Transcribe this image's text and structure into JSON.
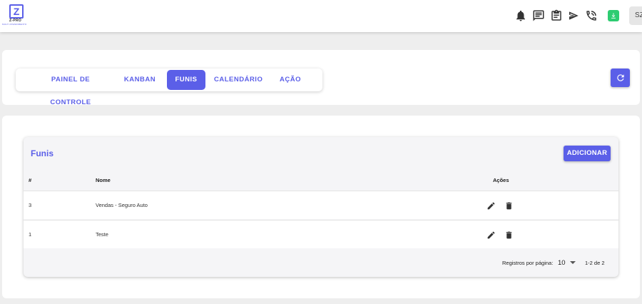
{
  "brand": {
    "name": "Z-PRO",
    "tagline": "MULTI ATENDIMENTO",
    "accent": "#5b5fe8"
  },
  "topbar": {
    "icons": [
      "bell-icon",
      "chat-icon",
      "clipboard-icon",
      "send-icon",
      "phone-icon",
      "download-icon"
    ],
    "avatar": "SZ"
  },
  "tabs": [
    {
      "label": "PAINEL DE CONTROLE",
      "active": false
    },
    {
      "label": "KANBAN",
      "active": false
    },
    {
      "label": "FUNIS",
      "active": true
    },
    {
      "label": "CALENDÁRIO",
      "active": false
    },
    {
      "label": "AÇÃO",
      "active": false
    }
  ],
  "card": {
    "title": "Funis",
    "add_label": "ADICIONAR",
    "columns": {
      "id": "#",
      "name": "Nome",
      "actions": "Ações"
    },
    "rows": [
      {
        "id": "3",
        "name": "Vendas - Seguro Auto"
      },
      {
        "id": "1",
        "name": "Teste"
      }
    ],
    "footer": {
      "per_page_label": "Registros por página:",
      "per_page": "10",
      "range": "1-2 de 2"
    }
  }
}
